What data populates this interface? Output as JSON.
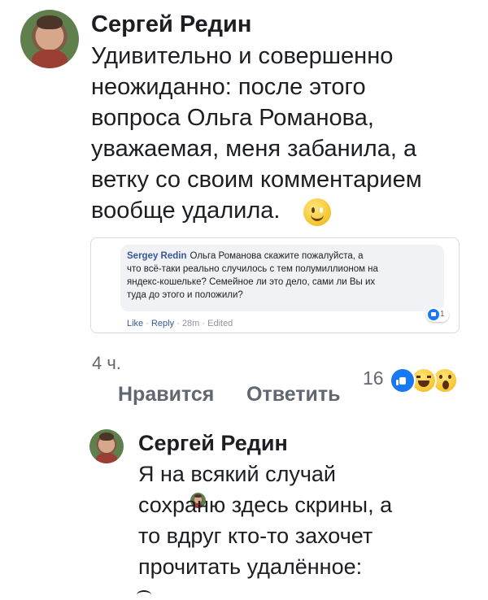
{
  "main_comment": {
    "author": "Сергей Редин",
    "text": "Удивительно и совершенно\nнеожиданно: после этого\nвопроса Ольга Романова,\nуважаемая, меня забанила, а\nветку со своим комментарием\nвообще удалила.",
    "emoji": "smile-icon",
    "time": "4 ч.",
    "like_label": "Нравится",
    "reply_label": "Ответить",
    "reactions": {
      "count": "16",
      "types": [
        "like",
        "haha",
        "wow"
      ]
    }
  },
  "embedded_comment": {
    "author": "Sergey Redin",
    "text": "Ольга Романова скажите пожалуйста, а\nчто всё-таки реально случилось с тем полумиллионом на\nяндекс-кошельке? Семейное ли это дело, сами ли Вы их\nтуда до этого и положили?",
    "reaction_count": "1",
    "like_label": "Like",
    "reply_label": "Reply",
    "time": "28m",
    "edited_label": "Edited",
    "separator": "·"
  },
  "reply_comment": {
    "author": "Сергей Редин",
    "text": "Я на всякий случай\nсохраню здесь скрины, а\nто вдруг кто-то захочет\nпрочитать удалённое:"
  },
  "colors": {
    "text": "#1c1e21",
    "muted": "#606770",
    "facebook_blue": "#1877f2",
    "link_blue": "#385898"
  }
}
